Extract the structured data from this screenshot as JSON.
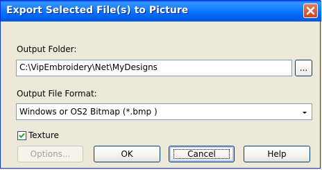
{
  "dialog": {
    "title": "Export Selected File(s) to Picture",
    "close_icon": "close-x-icon"
  },
  "output_folder": {
    "label": "Output Folder:",
    "value": "C:\\VipEmbroidery\\Net\\MyDesigns",
    "browse_label": "..."
  },
  "output_format": {
    "label": "Output File Format:",
    "selected": "Windows or OS2 Bitmap (*.bmp )",
    "arrow_icon": "dropdown-arrow-icon"
  },
  "texture": {
    "label": "Texture",
    "checked": true
  },
  "buttons": {
    "options": "Options...",
    "ok": "OK",
    "cancel": "Cancel",
    "help": "Help"
  },
  "colors": {
    "titlebar": "#0058EE",
    "window_bg": "#ECE9D8",
    "close_bg": "#C64825"
  }
}
